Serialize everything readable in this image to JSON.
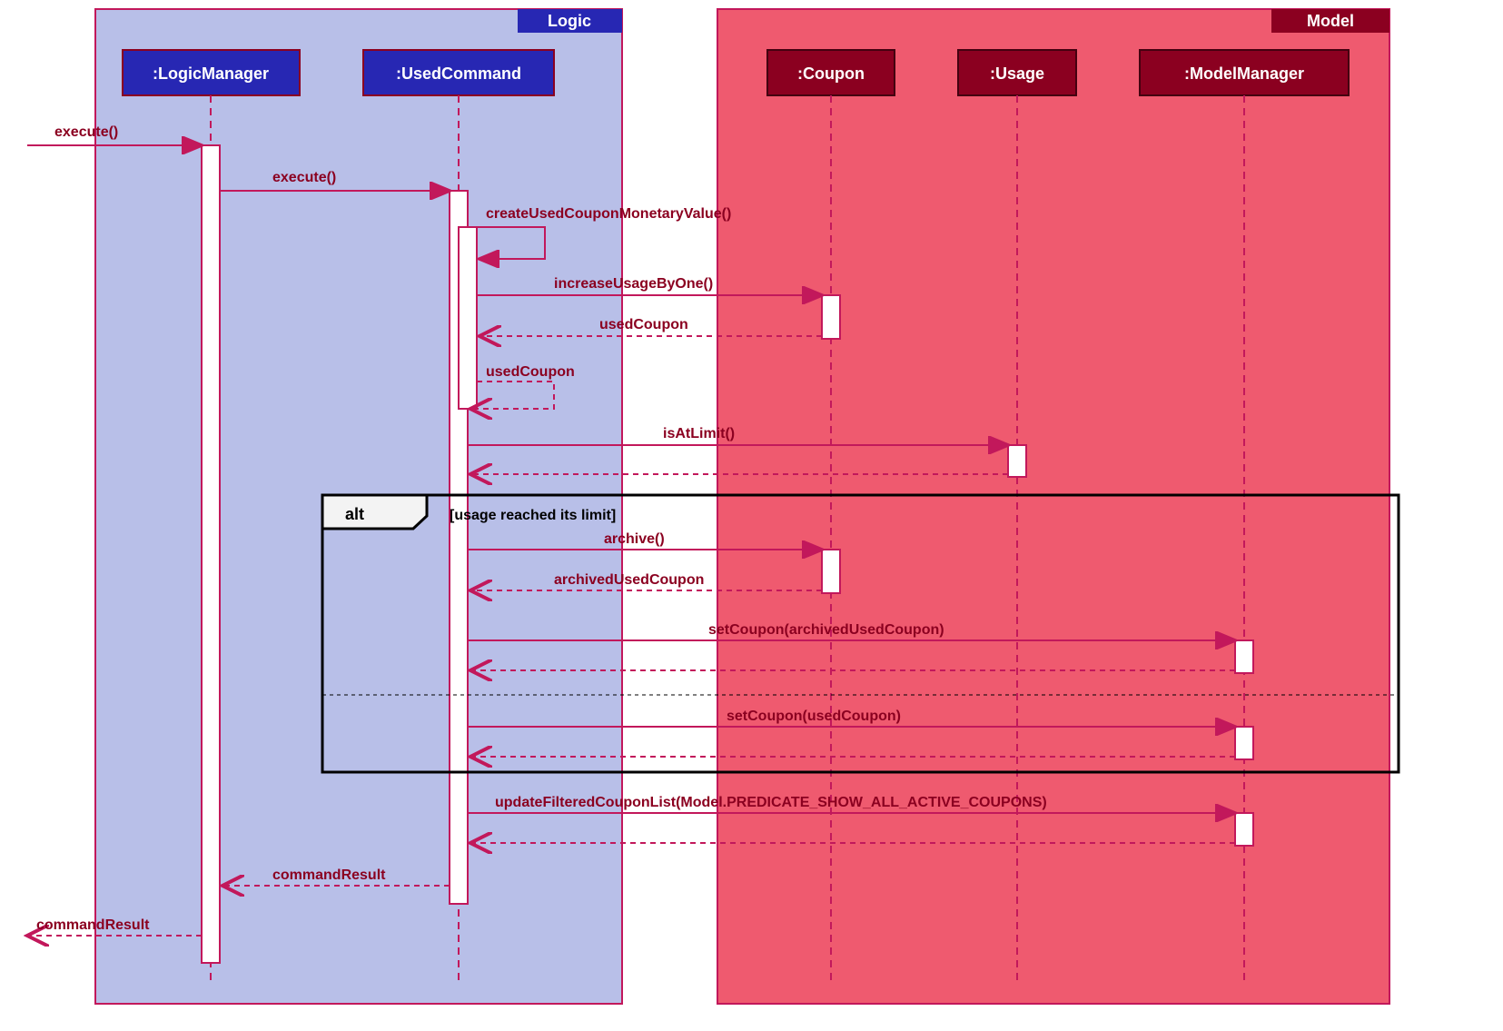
{
  "frames": {
    "logic": {
      "title": "Logic"
    },
    "model": {
      "title": "Model"
    }
  },
  "lifelines": {
    "logicManager": ":LogicManager",
    "usedCommand": ":UsedCommand",
    "coupon": ":Coupon",
    "usage": ":Usage",
    "modelManager": ":ModelManager"
  },
  "messages": {
    "m1": "execute()",
    "m2": "execute()",
    "m3": "createUsedCouponMonetaryValue()",
    "m4": "increaseUsageByOne()",
    "m5": "usedCoupon",
    "m6": "usedCoupon",
    "m7": "isAtLimit()",
    "m8": "archive()",
    "m9": "archivedUsedCoupon",
    "m10": "setCoupon(archivedUsedCoupon)",
    "m11": "setCoupon(usedCoupon)",
    "m12": "updateFilteredCouponList(Model.PREDICATE_SHOW_ALL_ACTIVE_COUPONS)",
    "m13": "commandResult",
    "m14": "commandResult"
  },
  "alt": {
    "label": "alt",
    "guard": "[usage reached its limit]"
  }
}
